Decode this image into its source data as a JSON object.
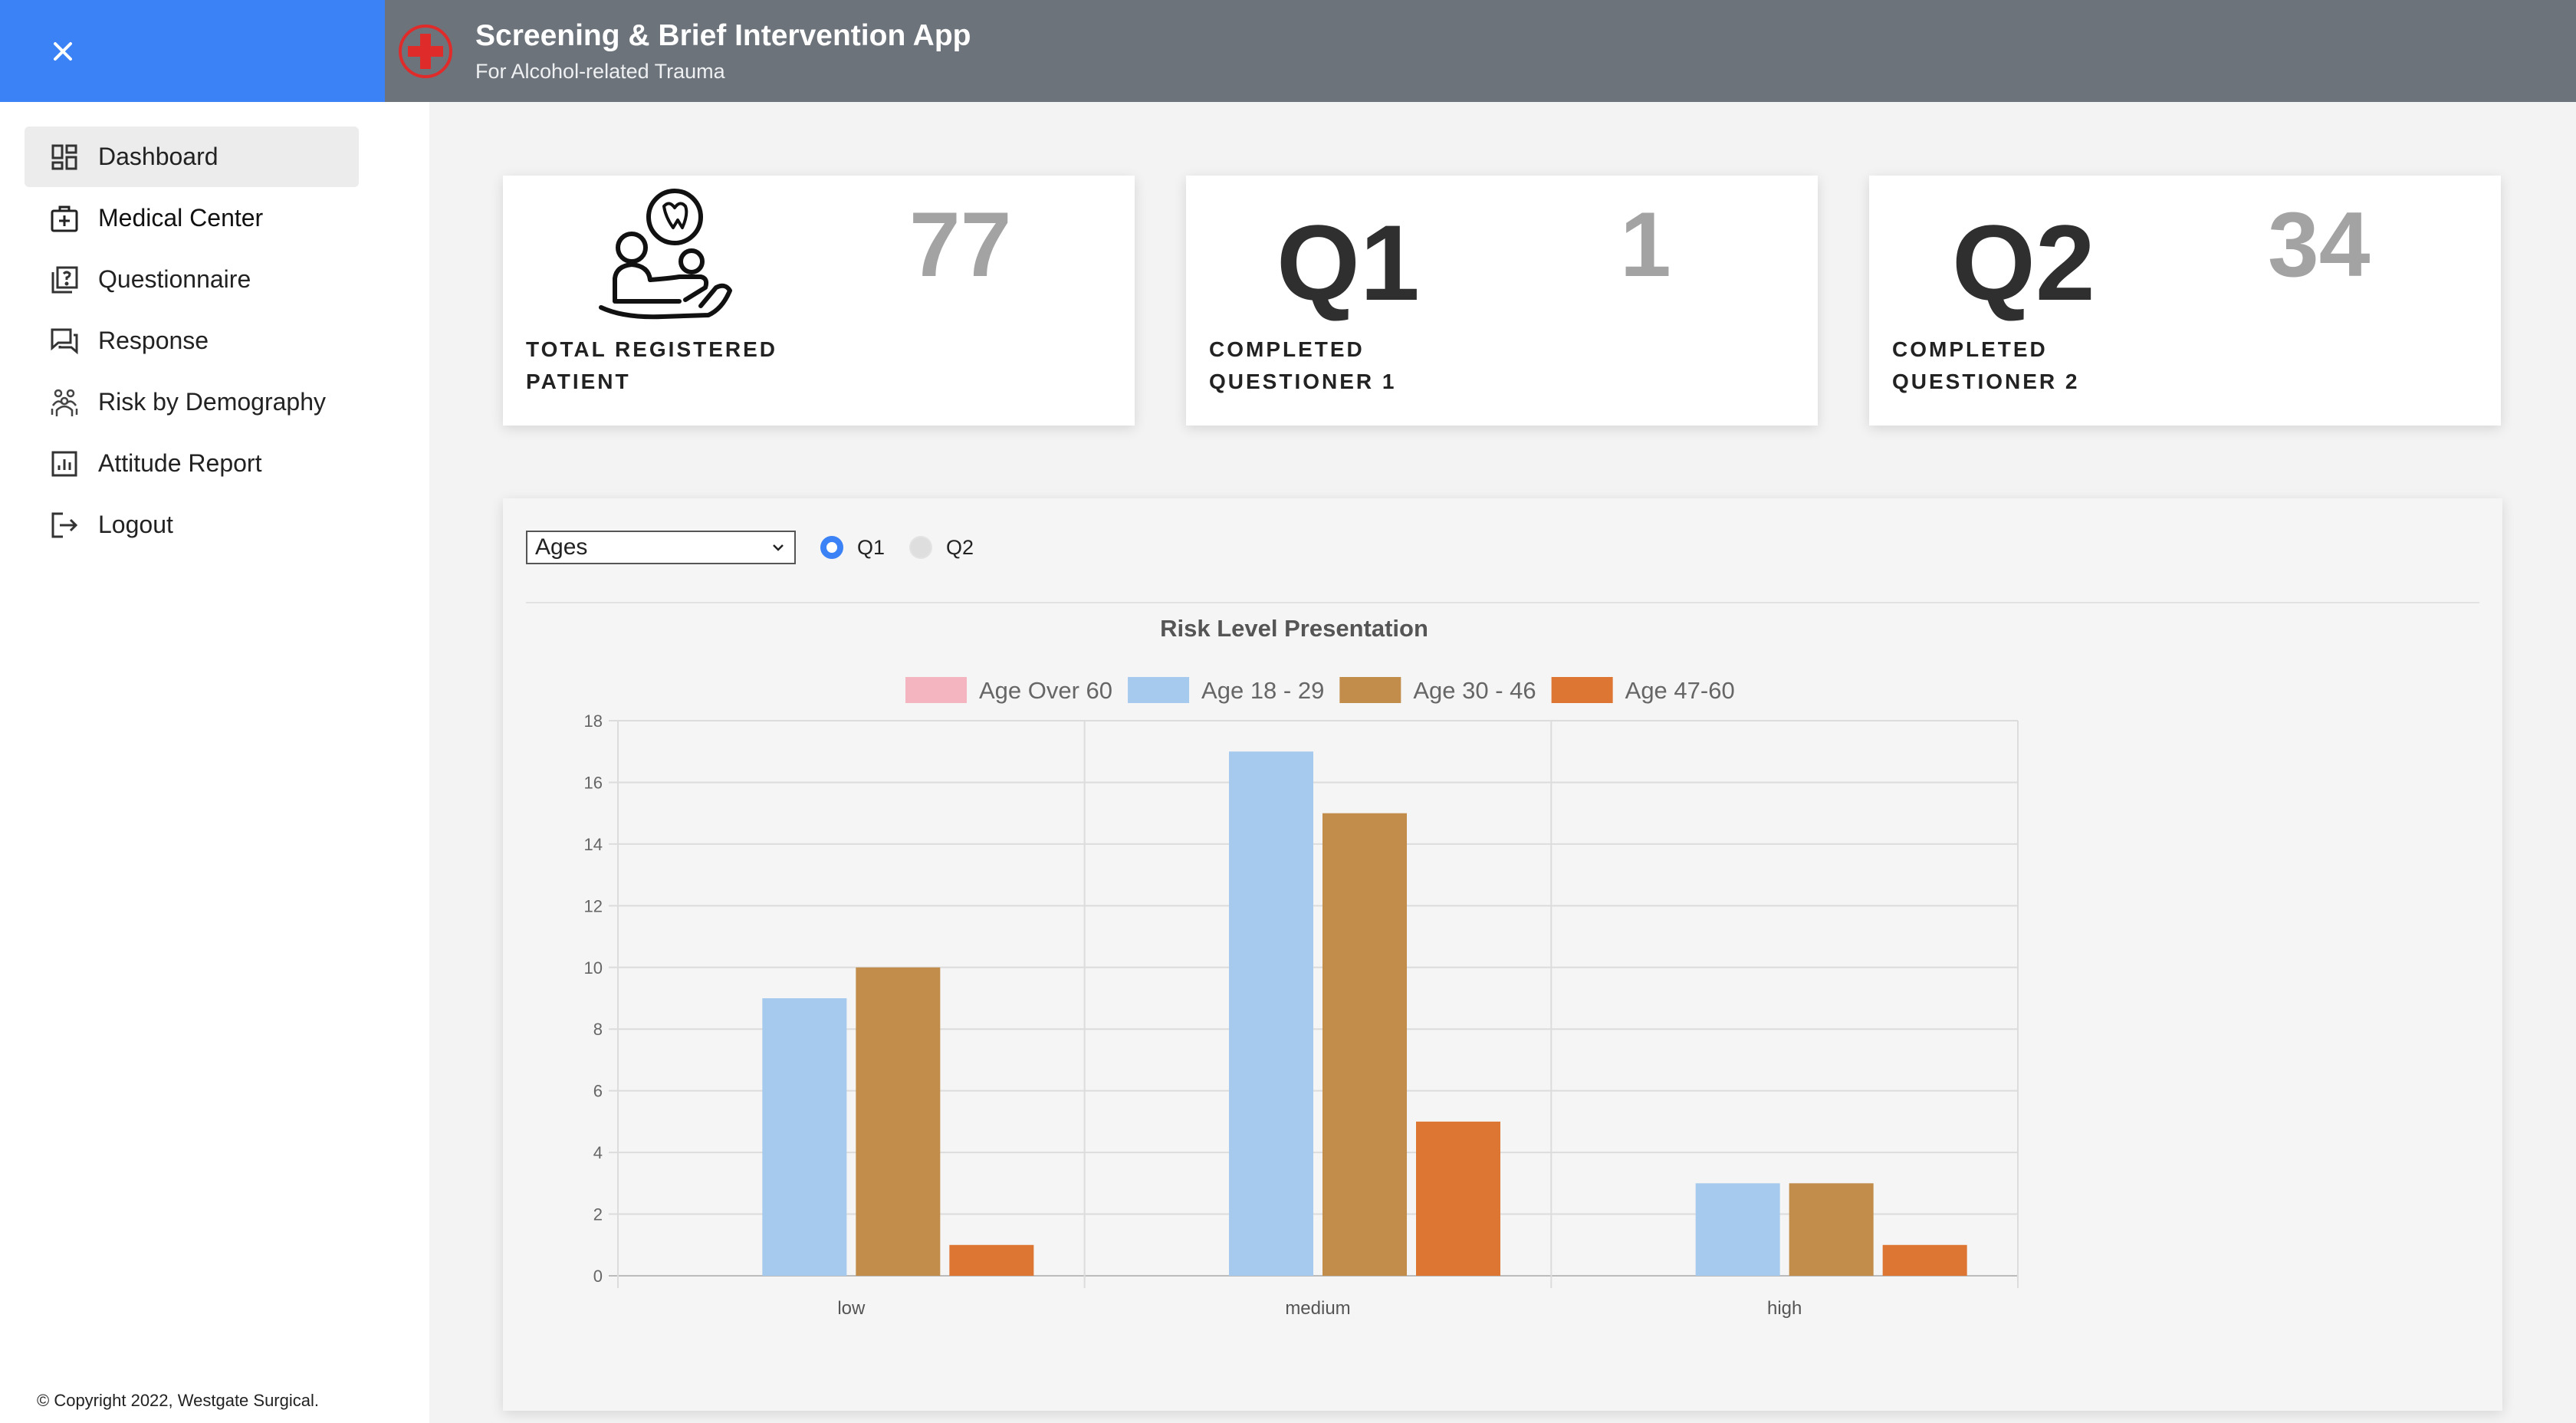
{
  "app": {
    "title": "Screening & Brief Intervention App",
    "subtitle": "For Alcohol-related Trauma"
  },
  "sidebar": {
    "items": [
      {
        "label": "Dashboard",
        "icon": "dashboard-icon"
      },
      {
        "label": "Medical Center",
        "icon": "medical-kit-icon"
      },
      {
        "label": "Questionnaire",
        "icon": "questionnaire-icon"
      },
      {
        "label": "Response",
        "icon": "response-chat-icon"
      },
      {
        "label": "Risk by Demography",
        "icon": "people-group-icon"
      },
      {
        "label": "Attitude Report",
        "icon": "bar-report-icon"
      },
      {
        "label": "Logout",
        "icon": "logout-icon"
      }
    ],
    "copyright": "© Copyright 2022, Westgate Surgical."
  },
  "cards": [
    {
      "count": "77",
      "label_line1": "TOTAL REGISTERED",
      "label_line2": "PATIENT",
      "icon": "patient-care-icon"
    },
    {
      "big": "Q1",
      "count": "1",
      "label_line1": "COMPLETED",
      "label_line2": "QUESTIONER 1"
    },
    {
      "big": "Q2",
      "count": "34",
      "label_line1": "COMPLETED",
      "label_line2": "QUESTIONER 2"
    }
  ],
  "filters": {
    "select_value": "Ages",
    "radio_q1": "Q1",
    "radio_q2": "Q2",
    "selected": "Q1"
  },
  "colors": {
    "accent": "#3b82f6",
    "topbar": "#6c737b"
  },
  "chart_data": {
    "type": "bar",
    "title": "Risk Level Presentation",
    "categories": [
      "low",
      "medium",
      "high"
    ],
    "series": [
      {
        "name": "Age Over 60",
        "color": "#f4b5c0",
        "values": [
          0,
          0,
          0
        ]
      },
      {
        "name": "Age 18 - 29",
        "color": "#a6c9ee",
        "values": [
          9,
          17,
          3
        ]
      },
      {
        "name": "Age 30 - 46",
        "color": "#c28d4a",
        "values": [
          10,
          15,
          3
        ]
      },
      {
        "name": "Age 47-60",
        "color": "#dd7533",
        "values": [
          1,
          5,
          1
        ]
      }
    ],
    "ylim": [
      0,
      18
    ],
    "yticks": [
      0,
      2,
      4,
      6,
      8,
      10,
      12,
      14,
      16,
      18
    ],
    "legend": "top",
    "grid": true
  }
}
